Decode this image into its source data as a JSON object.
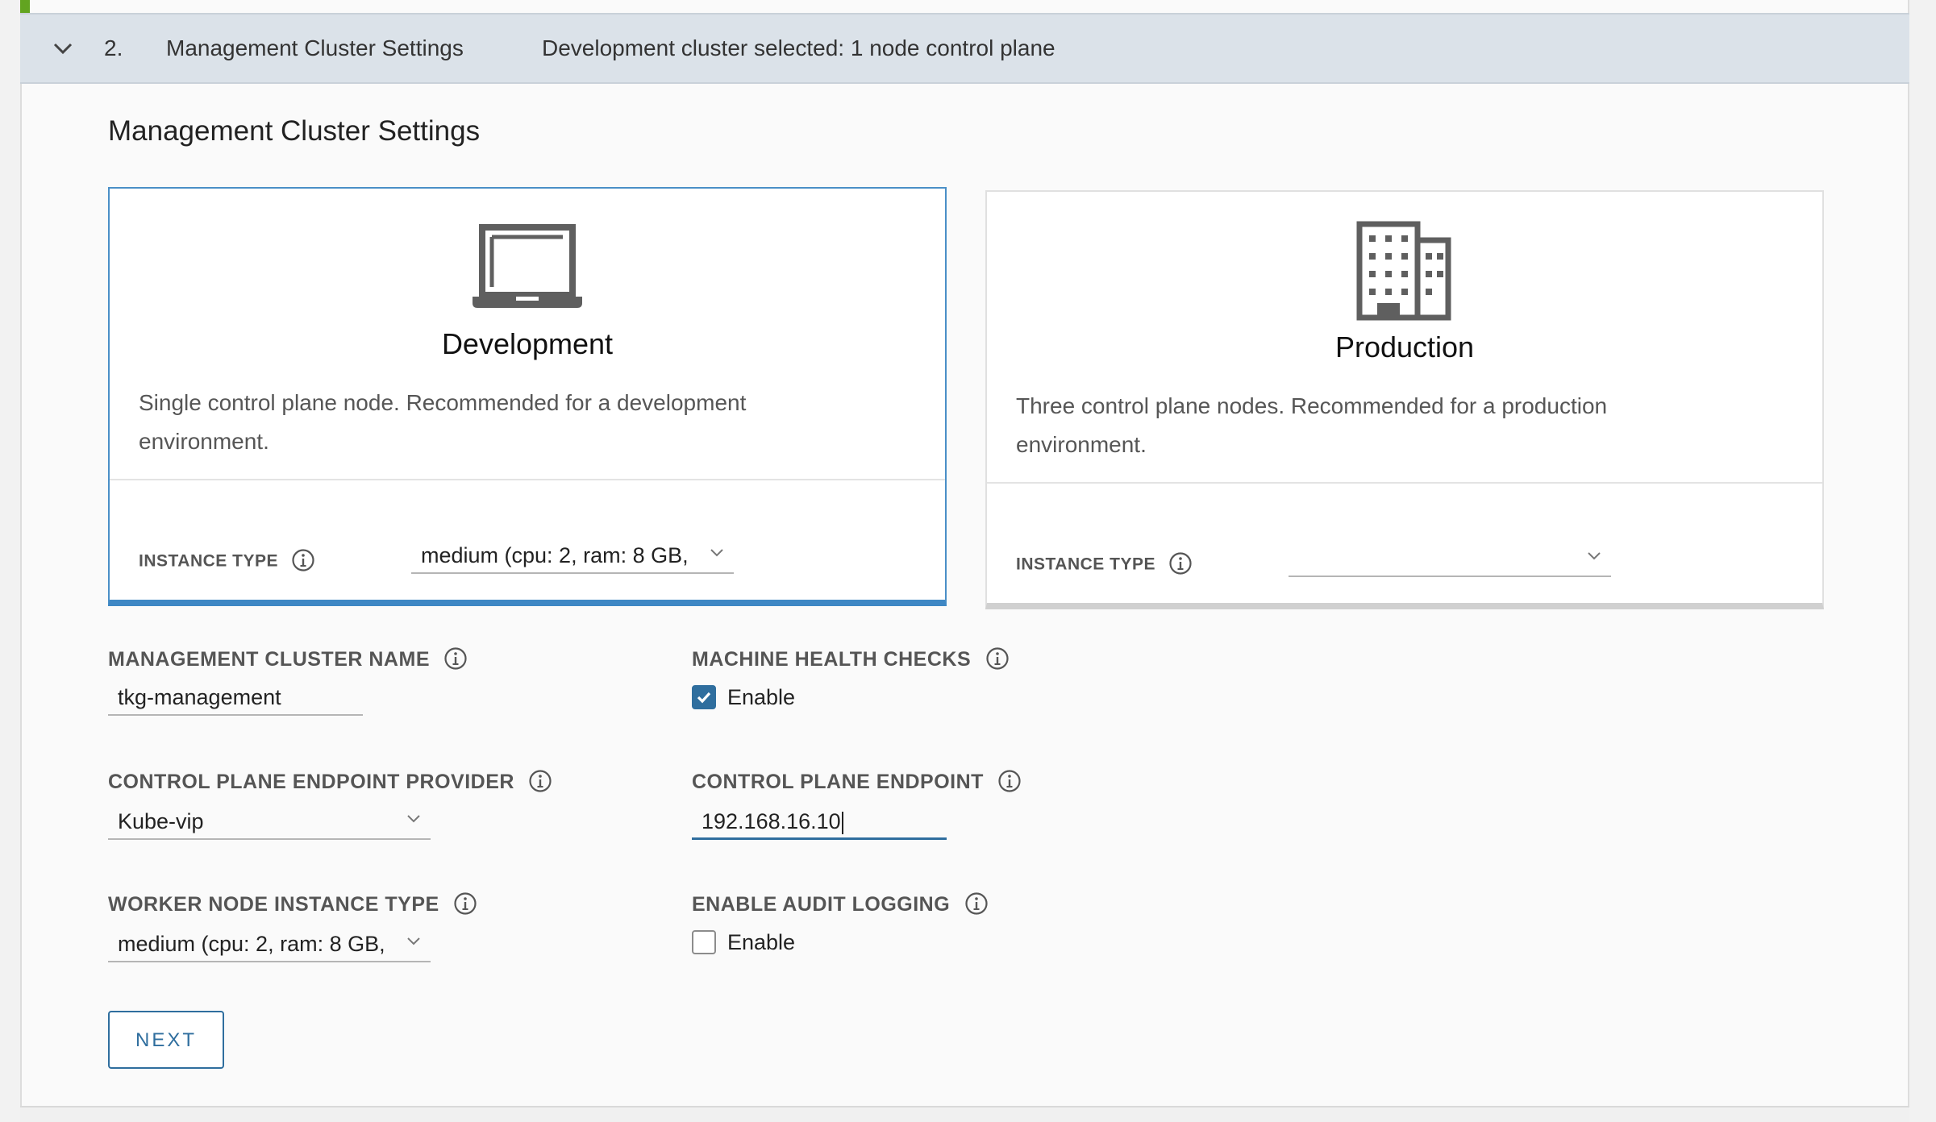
{
  "step": {
    "number": "2.",
    "title": "Management Cluster Settings",
    "summary": "Development cluster selected: 1 node control plane"
  },
  "section_title": "Management Cluster Settings",
  "cards": {
    "development": {
      "name": "Development",
      "description": "Single control plane node. Recommended for a development environment.",
      "instance_type_label": "INSTANCE TYPE",
      "instance_type_value": "medium (cpu: 2, ram: 8 GB,",
      "icon": "laptop-icon",
      "selected": true
    },
    "production": {
      "name": "Production",
      "description": "Three control plane nodes. Recommended for a production environment.",
      "instance_type_label": "INSTANCE TYPE",
      "instance_type_value": "",
      "icon": "building-icon",
      "selected": false
    }
  },
  "fields": {
    "cluster_name": {
      "label": "MANAGEMENT CLUSTER NAME",
      "value": "tkg-management"
    },
    "machine_health": {
      "label": "MACHINE HEALTH CHECKS",
      "checkbox_label": "Enable",
      "checked": true
    },
    "endpoint_provider": {
      "label": "CONTROL PLANE ENDPOINT PROVIDER",
      "value": "Kube-vip"
    },
    "endpoint": {
      "label": "CONTROL PLANE ENDPOINT",
      "value": "192.168.16.10"
    },
    "worker_instance": {
      "label": "WORKER NODE INSTANCE TYPE",
      "value": "medium (cpu: 2, ram: 8 GB,"
    },
    "audit_logging": {
      "label": "ENABLE AUDIT LOGGING",
      "checkbox_label": "Enable",
      "checked": false
    }
  },
  "next_button": "NEXT",
  "colors": {
    "accent": "#2f6e9e",
    "header_bg": "#dbe2e9",
    "selected_border": "#3e87c4",
    "status_green": "#62a420"
  }
}
